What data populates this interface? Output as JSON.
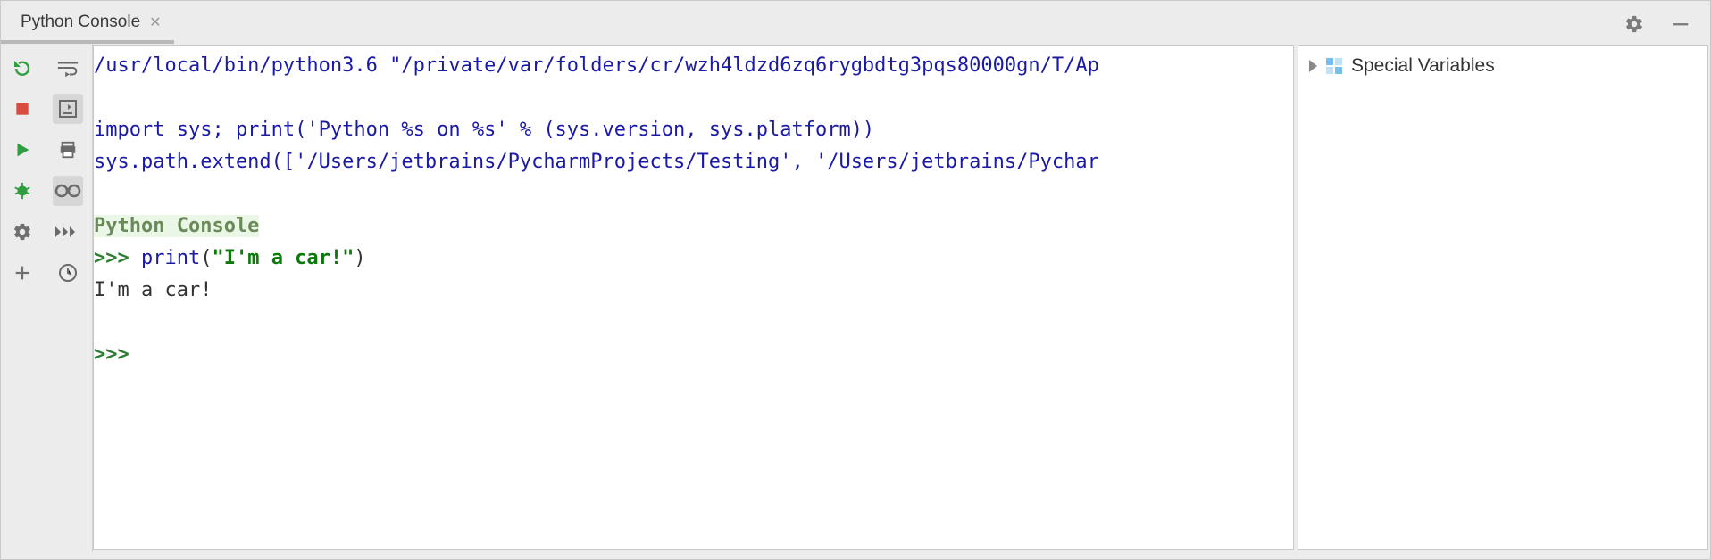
{
  "header": {
    "tab_title": "Python Console"
  },
  "console": {
    "line_interp": "/usr/local/bin/python3.6 \"/private/var/folders/cr/wzh4ldzd6zq6rygbdtg3pqs80000gn/T/Ap",
    "line_import": "import sys; print('Python %s on %s' % (sys.version, sys.platform))",
    "line_extend": "sys.path.extend(['/Users/jetbrains/PycharmProjects/Testing', '/Users/jetbrains/Pychar",
    "title_label": "Python Console",
    "prompt1": ">>> ",
    "cmd1_func": "print",
    "cmd1_open": "(",
    "cmd1_str": "\"I'm a car!\"",
    "cmd1_close": ")",
    "output1": "I'm a car!",
    "prompt2": ">>> "
  },
  "variables": {
    "special_label": "Special Variables"
  },
  "icons": {
    "gear": "settings",
    "minimize": "minimize",
    "rerun": "rerun",
    "stop": "stop",
    "play": "play",
    "debug": "debug",
    "settings2": "settings",
    "add": "add",
    "wrap": "soft-wrap",
    "scroll_end": "scroll-to-end",
    "print": "print",
    "vars": "show-variables",
    "cmd_history": "command-history",
    "history": "history"
  }
}
